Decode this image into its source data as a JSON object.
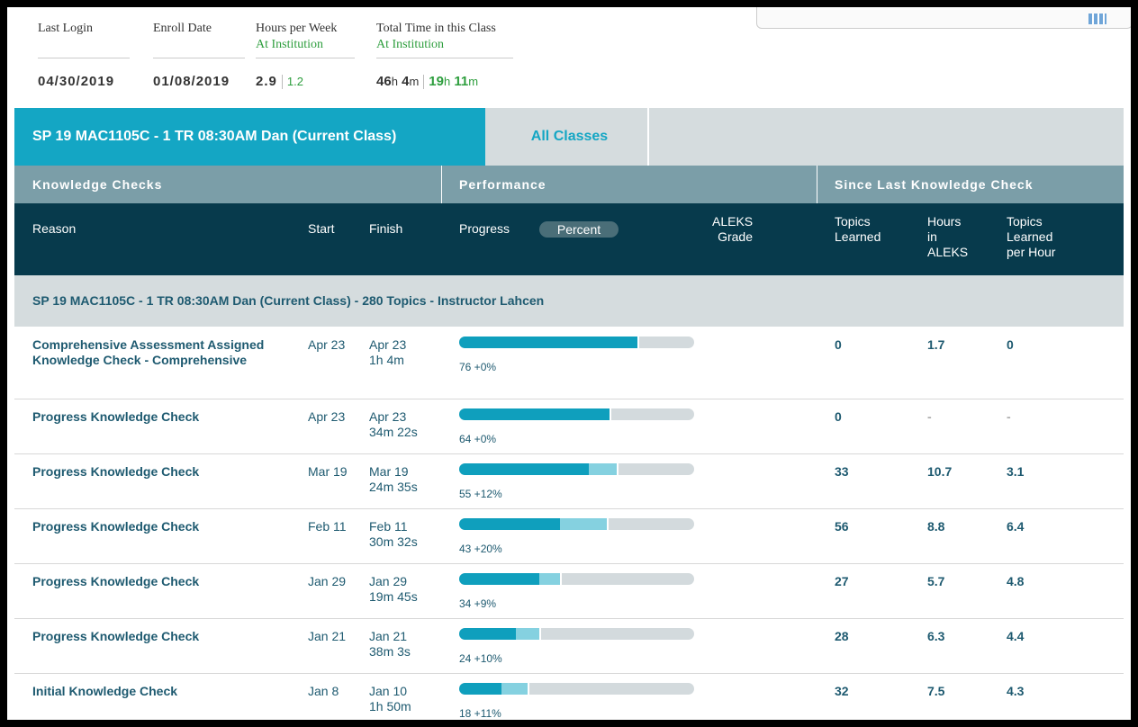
{
  "stats": {
    "last_login_label": "Last Login",
    "last_login_value": "04/30/2019",
    "enroll_date_label": "Enroll Date",
    "enroll_date_value": "01/08/2019",
    "hours_per_week_label": "Hours per Week",
    "hours_per_week_sub": "At Institution",
    "hours_per_week_value": "2.9",
    "hours_per_week_inst": "1.2",
    "total_time_label": "Total Time in this Class",
    "total_time_sub": "At Institution",
    "total_time_h": "46",
    "total_time_m": "4",
    "total_time_inst_h": "19",
    "total_time_inst_m": "11",
    "h_unit": "h",
    "m_unit": "m"
  },
  "tabs": {
    "current": "SP 19 MAC1105C - 1 TR 08:30AM Dan (Current Class)",
    "all": "All Classes"
  },
  "groups": {
    "knowledge_checks": "Knowledge Checks",
    "performance": "Performance",
    "since_last": "Since Last Knowledge Check"
  },
  "columns": {
    "reason": "Reason",
    "start": "Start",
    "finish": "Finish",
    "progress": "Progress",
    "percent": "Percent",
    "aleks_grade_1": "ALEKS",
    "aleks_grade_2": "Grade",
    "topics_learned_1": "Topics",
    "topics_learned_2": "Learned",
    "hours_1": "Hours",
    "hours_2": "in",
    "hours_3": "ALEKS",
    "tlph_1": "Topics",
    "tlph_2": "Learned",
    "tlph_3": "per Hour"
  },
  "class_title": "SP 19 MAC1105C - 1 TR 08:30AM Dan (Current Class) - 280 Topics - Instructor Lahcen",
  "rows": [
    {
      "reason": "Comprehensive Assessment Assigned Knowledge Check - Comprehensive",
      "start": "Apr 23",
      "finish_date": "Apr 23",
      "finish_time": "1h 4m",
      "base": 76,
      "gain": 0,
      "pct_label": "76 +0%",
      "topics": "0",
      "hours": "1.7",
      "tlph": "0"
    },
    {
      "reason": "Progress Knowledge Check",
      "start": "Apr 23",
      "finish_date": "Apr 23",
      "finish_time": "34m 22s",
      "base": 64,
      "gain": 0,
      "pct_label": "64 +0%",
      "topics": "0",
      "hours": "-",
      "tlph": "-"
    },
    {
      "reason": "Progress Knowledge Check",
      "start": "Mar 19",
      "finish_date": "Mar 19",
      "finish_time": "24m 35s",
      "base": 55,
      "gain": 12,
      "pct_label": "55 +12%",
      "topics": "33",
      "hours": "10.7",
      "tlph": "3.1"
    },
    {
      "reason": "Progress Knowledge Check",
      "start": "Feb 11",
      "finish_date": "Feb 11",
      "finish_time": "30m 32s",
      "base": 43,
      "gain": 20,
      "pct_label": "43 +20%",
      "topics": "56",
      "hours": "8.8",
      "tlph": "6.4"
    },
    {
      "reason": "Progress Knowledge Check",
      "start": "Jan 29",
      "finish_date": "Jan 29",
      "finish_time": "19m 45s",
      "base": 34,
      "gain": 9,
      "pct_label": "34 +9%",
      "topics": "27",
      "hours": "5.7",
      "tlph": "4.8"
    },
    {
      "reason": "Progress Knowledge Check",
      "start": "Jan 21",
      "finish_date": "Jan 21",
      "finish_time": "38m 3s",
      "base": 24,
      "gain": 10,
      "pct_label": "24 +10%",
      "topics": "28",
      "hours": "6.3",
      "tlph": "4.4"
    },
    {
      "reason": "Initial Knowledge Check",
      "start": "Jan 8",
      "finish_date": "Jan 10",
      "finish_time": "1h 50m",
      "base": 18,
      "gain": 11,
      "pct_label": "18 +11%",
      "topics": "32",
      "hours": "7.5",
      "tlph": "4.3"
    }
  ],
  "colors": {
    "accent": "#14a6c4",
    "header_dark": "#073a4c",
    "group_header": "#7b9ea8",
    "progress_base": "#0f9fbd",
    "progress_gain": "#85d1e0",
    "institution_green": "#2e9e3e"
  }
}
